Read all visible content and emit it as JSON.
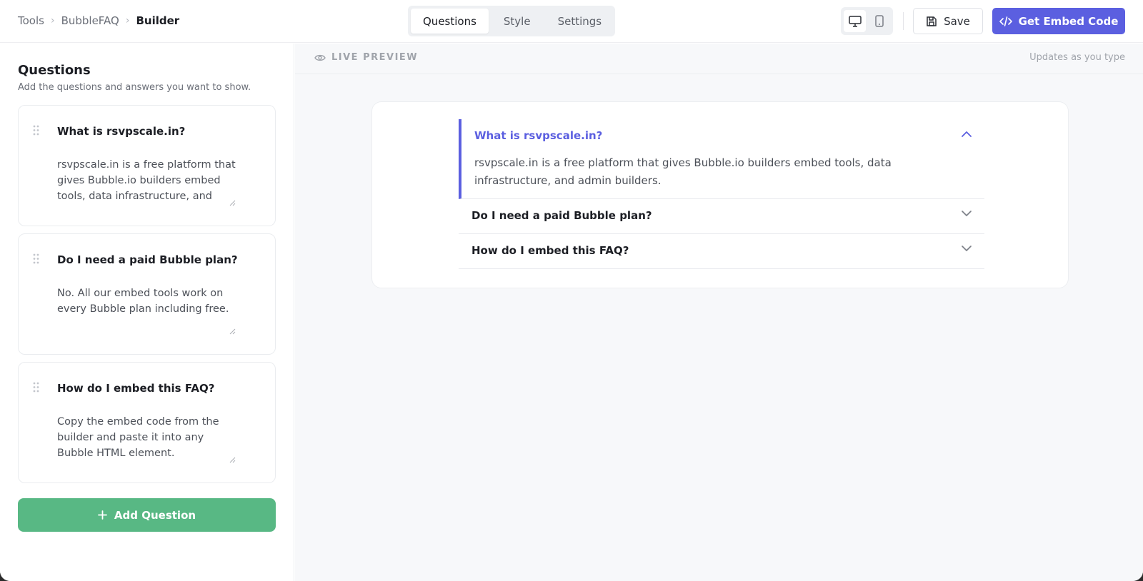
{
  "breadcrumb": [
    {
      "label": "Tools"
    },
    {
      "label": "BubbleFAQ"
    },
    {
      "label": "Builder"
    }
  ],
  "tabs": [
    {
      "label": "Questions",
      "active": true
    },
    {
      "label": "Style",
      "active": false
    },
    {
      "label": "Settings",
      "active": false
    }
  ],
  "device_toggle": {
    "selected": "desktop",
    "options": [
      "desktop-icon",
      "mobile-icon"
    ]
  },
  "toolbar": {
    "save_label": "Save",
    "embed_label": "Get Embed Code"
  },
  "questions_panel": {
    "title": "Questions",
    "subtitle": "Add the questions and answers you want to show.",
    "items": [
      {
        "question": "What is rsvpscale.in?",
        "answer": "rsvpscale.in is a free platform that gives Bubble.io builders embed tools, data infrastructure, and admin builders."
      },
      {
        "question": "Do I need a paid Bubble plan?",
        "answer": "No. All our embed tools work on every Bubble plan including free."
      },
      {
        "question": "How do I embed this FAQ?",
        "answer": "Copy the embed code from the builder and paste it into any Bubble HTML element."
      }
    ],
    "add_label": "Add Question"
  },
  "preview": {
    "label": "LIVE PREVIEW",
    "hint": "Updates as you type",
    "faq": [
      {
        "question": "What is rsvpscale.in?",
        "answer": "rsvpscale.in is a free platform that gives Bubble.io builders embed tools, data infrastructure, and admin builders.",
        "expanded": true
      },
      {
        "question": "Do I need a paid Bubble plan?",
        "expanded": false
      },
      {
        "question": "How do I embed this FAQ?",
        "expanded": false
      }
    ]
  },
  "colors": {
    "accent": "#5b5fe0",
    "add_button": "#58b884",
    "text": "#1c1e24",
    "muted": "#6b6f78"
  }
}
